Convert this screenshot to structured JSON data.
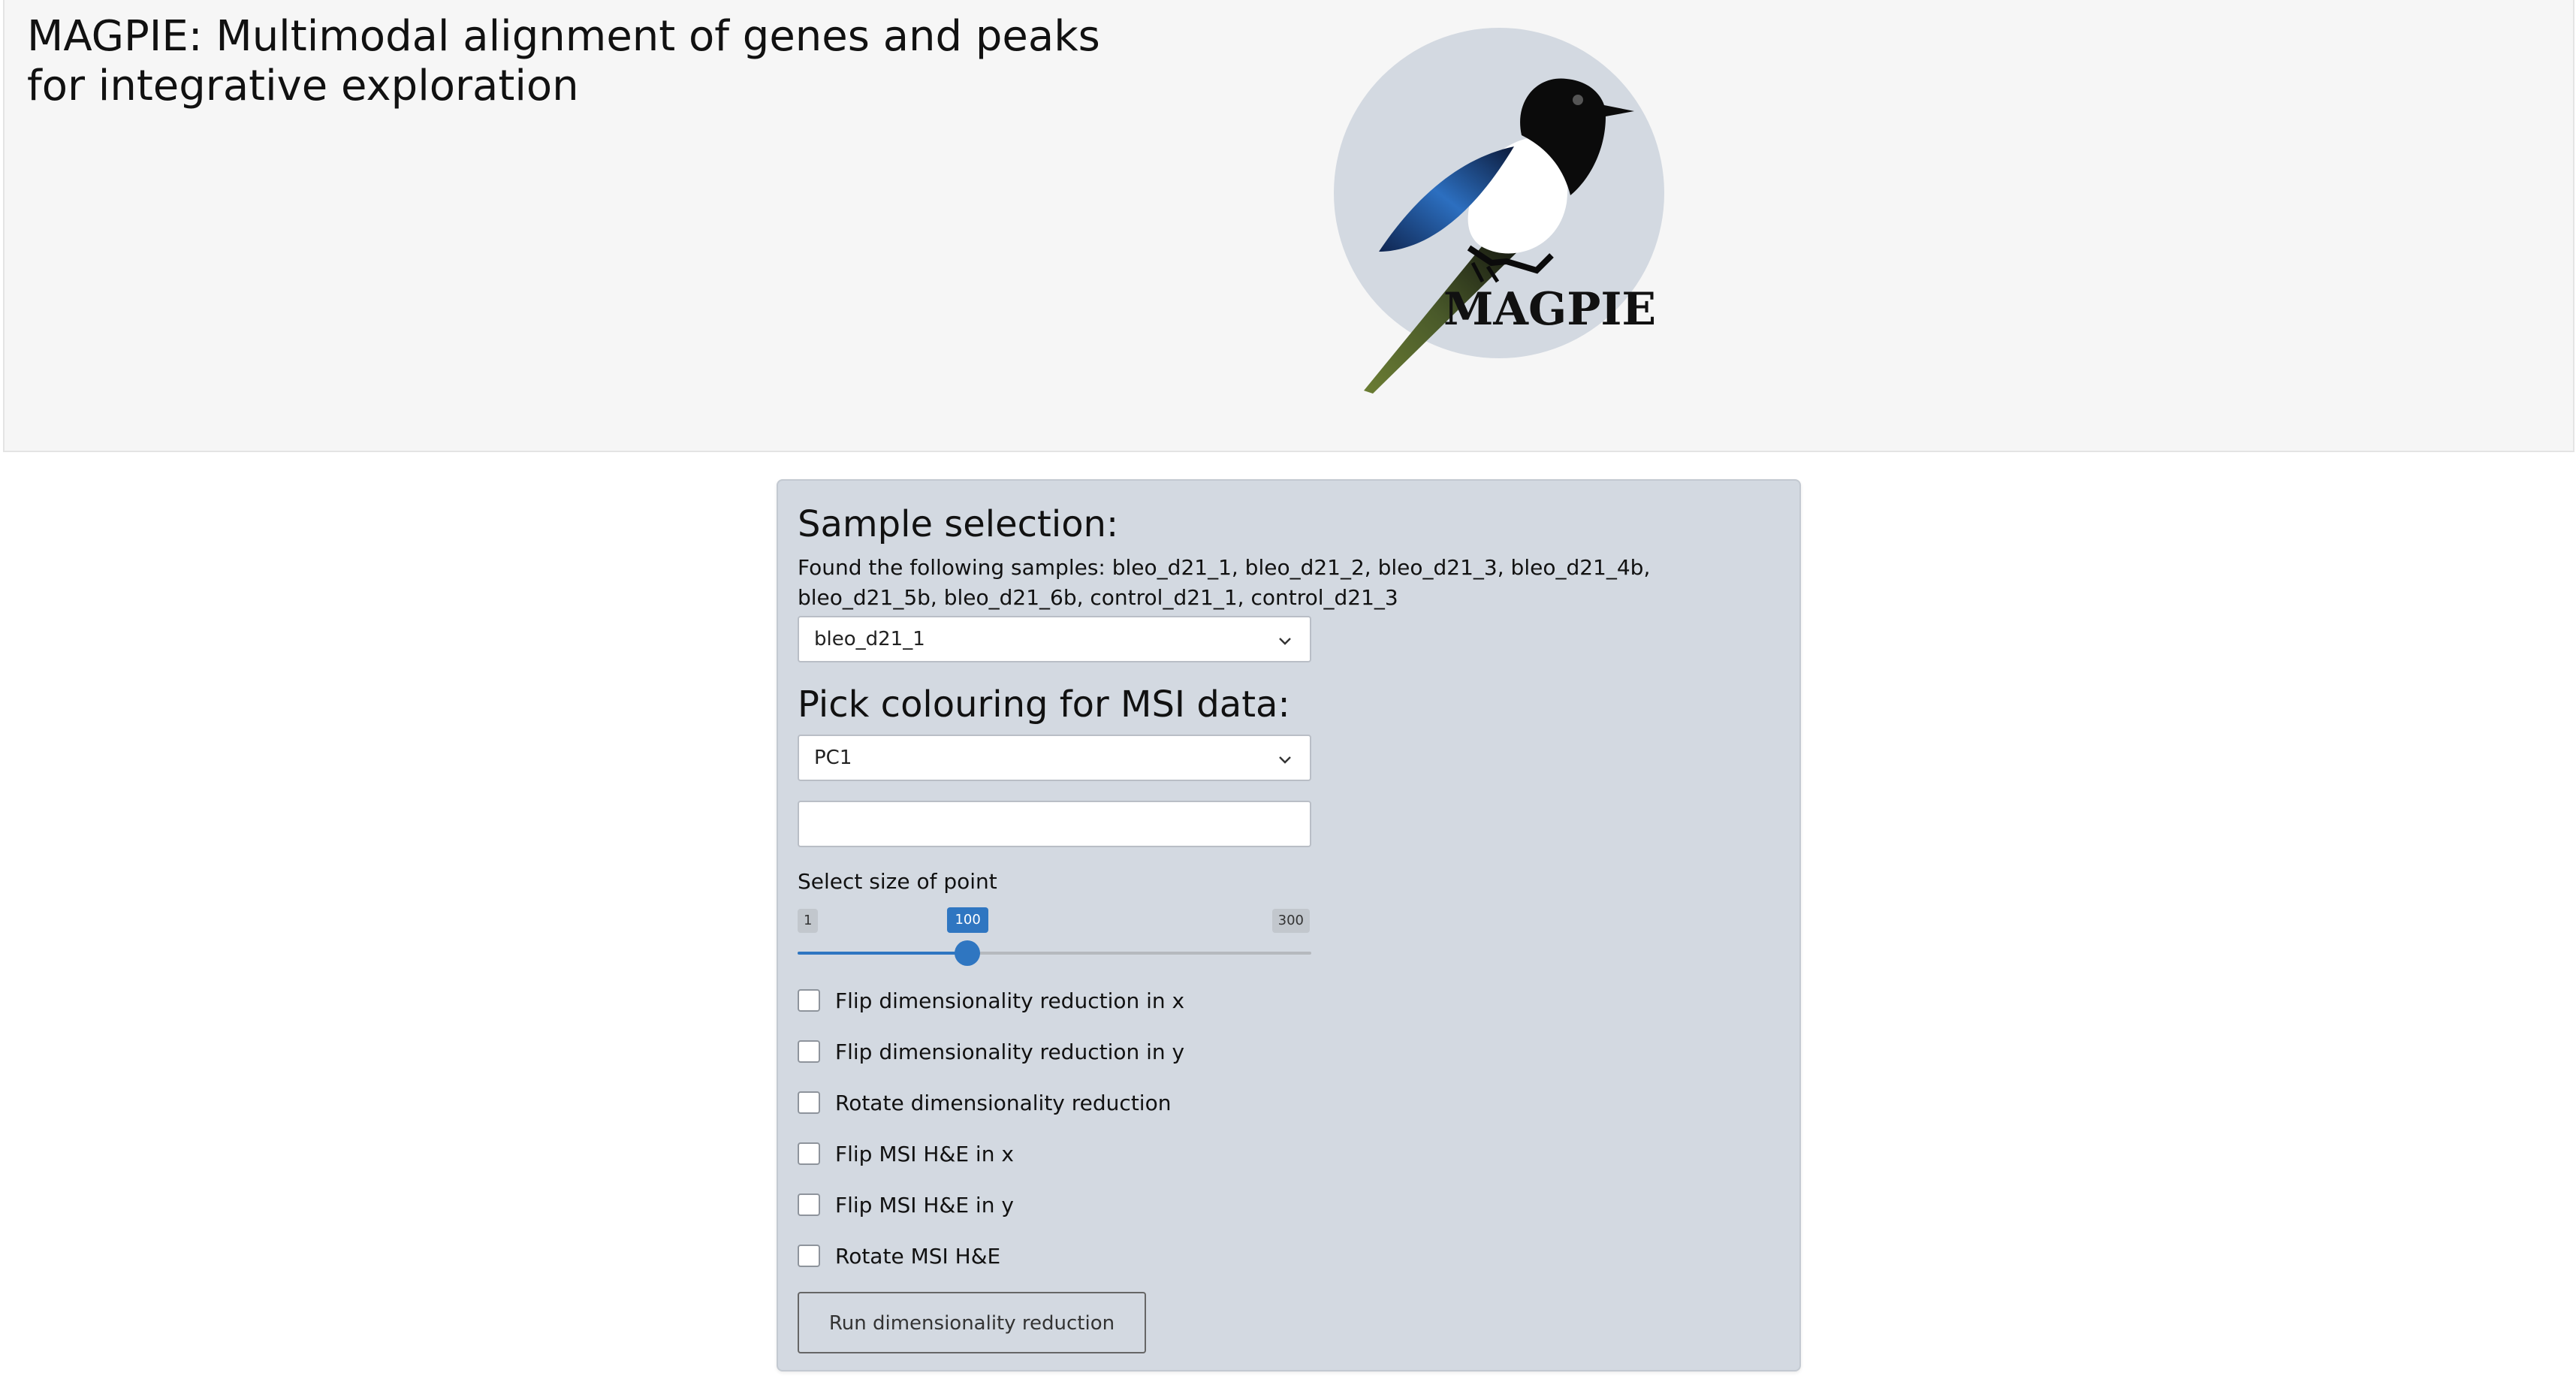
{
  "header": {
    "title": "MAGPIE: Multimodal alignment of genes and peaks for integrative exploration",
    "logo_text": "MAGPIE"
  },
  "sample_section": {
    "heading": "Sample selection:",
    "found_text": "Found the following samples: bleo_d21_1, bleo_d21_2, bleo_d21_3, bleo_d21_4b, bleo_d21_5b, bleo_d21_6b, control_d21_1, control_d21_3",
    "selected_sample": "bleo_d21_1"
  },
  "colouring_section": {
    "heading": "Pick colouring for MSI data:",
    "selected_colouring": "PC1",
    "text_value": ""
  },
  "slider": {
    "label": "Select size of point",
    "min": 1,
    "max": 300,
    "value": 100,
    "min_label": "1",
    "max_label": "300",
    "value_label": "100"
  },
  "checkboxes": [
    {
      "label": "Flip dimensionality reduction in x",
      "checked": false
    },
    {
      "label": "Flip dimensionality reduction in y",
      "checked": false
    },
    {
      "label": "Rotate dimensionality reduction",
      "checked": false
    },
    {
      "label": "Flip MSI H&E in x",
      "checked": false
    },
    {
      "label": "Flip MSI H&E in y",
      "checked": false
    },
    {
      "label": "Rotate MSI H&E",
      "checked": false
    }
  ],
  "run_button_label": "Run dimensionality reduction",
  "colors": {
    "accent": "#2f76c1",
    "panel_background": "#d3d9e1",
    "header_background": "#f6f6f6"
  }
}
